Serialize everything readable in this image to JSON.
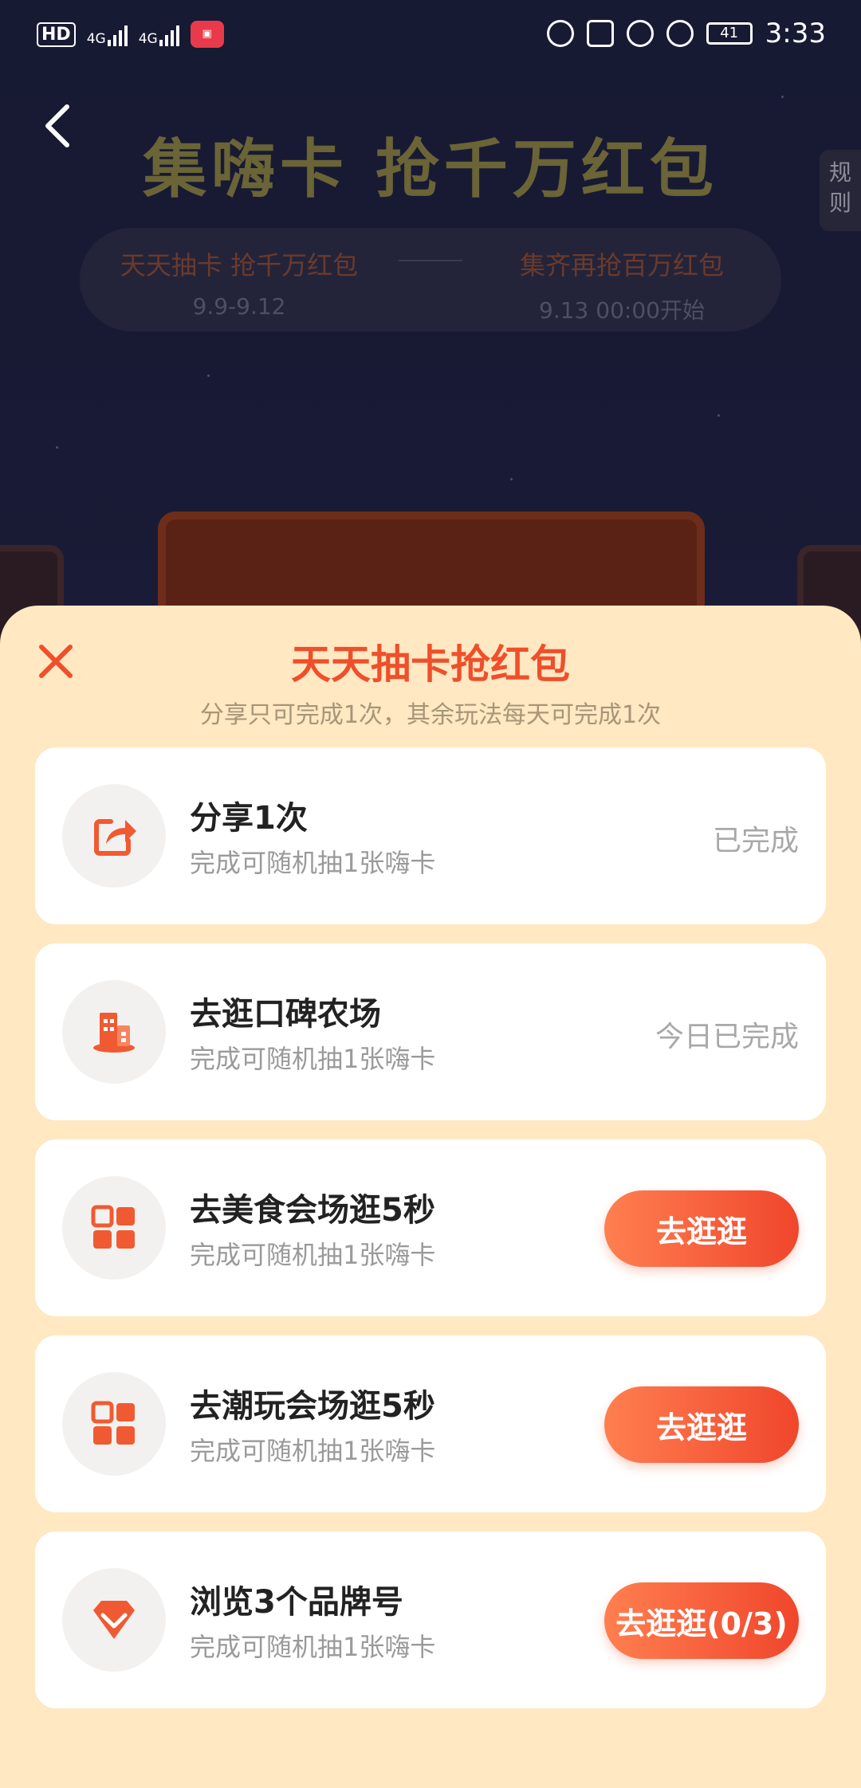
{
  "status_bar": {
    "hd": "HD",
    "net1": "4G",
    "net2": "4G",
    "battery": "41",
    "time": "3:33"
  },
  "header": {
    "title": "集嗨卡 抢千万红包",
    "rules": "规\n则"
  },
  "stages": [
    {
      "title": "天天抽卡 抢千万红包",
      "date": "9.9-9.12"
    },
    {
      "title": "集齐再抢百万红包",
      "date": "9.13 00:00开始"
    }
  ],
  "sheet": {
    "title": "天天抽卡抢红包",
    "subtitle": "分享只可完成1次，其余玩法每天可完成1次",
    "tasks": [
      {
        "icon": "share-icon",
        "title": "分享1次",
        "desc": "完成可随机抽1张嗨卡",
        "status": "已完成"
      },
      {
        "icon": "building-icon",
        "title": "去逛口碑农场",
        "desc": "完成可随机抽1张嗨卡",
        "status": "今日已完成"
      },
      {
        "icon": "grid-icon",
        "title": "去美食会场逛5秒",
        "desc": "完成可随机抽1张嗨卡",
        "button": "去逛逛"
      },
      {
        "icon": "grid-icon",
        "title": "去潮玩会场逛5秒",
        "desc": "完成可随机抽1张嗨卡",
        "button": "去逛逛"
      },
      {
        "icon": "diamond-icon",
        "title": "浏览3个品牌号",
        "desc": "完成可随机抽1张嗨卡",
        "button": "去逛逛(0/3)"
      }
    ]
  },
  "colors": {
    "accent": "#ef4f2b",
    "sheet_bg": "#ffe8c2",
    "button_start": "#ff7f50",
    "button_end": "#f0462c"
  }
}
